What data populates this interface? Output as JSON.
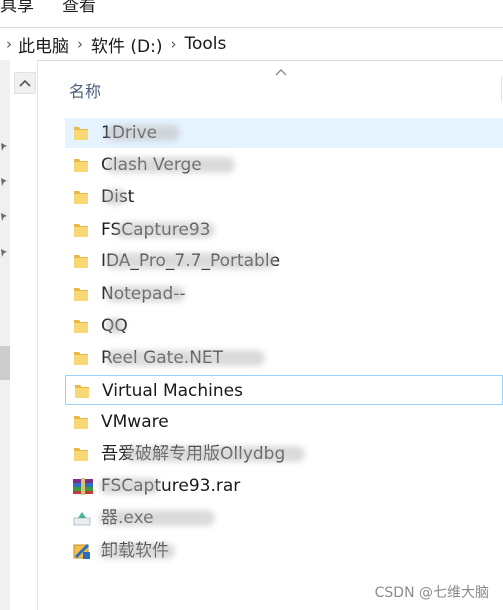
{
  "ribbon": {
    "tab_1": "具享",
    "tab_2": "查看"
  },
  "breadcrumb": {
    "items": [
      "此电脑",
      "软件 (D:)",
      "Tools"
    ],
    "separator": "›"
  },
  "columns": {
    "name_header": "名称"
  },
  "files": [
    {
      "name": "1Drive",
      "type": "folder",
      "blurred": true
    },
    {
      "name": "Clash Verge",
      "type": "folder",
      "blurred": true
    },
    {
      "name": "Dist",
      "type": "folder",
      "blurred": true
    },
    {
      "name": "FSCapture93",
      "type": "folder",
      "blurred": true
    },
    {
      "name": "IDA_Pro_7.7_Portable",
      "type": "folder",
      "blurred": true
    },
    {
      "name": "Notepad--",
      "type": "folder",
      "blurred": true
    },
    {
      "name": "QQ",
      "type": "folder",
      "blurred": true
    },
    {
      "name": "Reel Gate.NET",
      "type": "folder",
      "blurred": true
    },
    {
      "name": "Virtual Machines",
      "type": "folder",
      "blurred": false,
      "state": "focused"
    },
    {
      "name": "VMware",
      "type": "folder",
      "blurred": false
    },
    {
      "name": "吾爱破解专用版Ollydbg",
      "type": "folder",
      "blurred": true
    },
    {
      "name": "FSCapture93.rar",
      "type": "rar-archive",
      "blurred": true
    },
    {
      "name": "器.exe",
      "type": "exe",
      "blurred": true
    },
    {
      "name": "卸载软件",
      "type": "uninstaller",
      "blurred": true
    }
  ],
  "watermark": "CSDN @七维大脑",
  "colors": {
    "folder": "#f8d775",
    "folder_dark": "#e8b84a",
    "hover_row": "#e5f3ff",
    "focus_border": "#99d1ff",
    "header_text": "#4c607a"
  }
}
